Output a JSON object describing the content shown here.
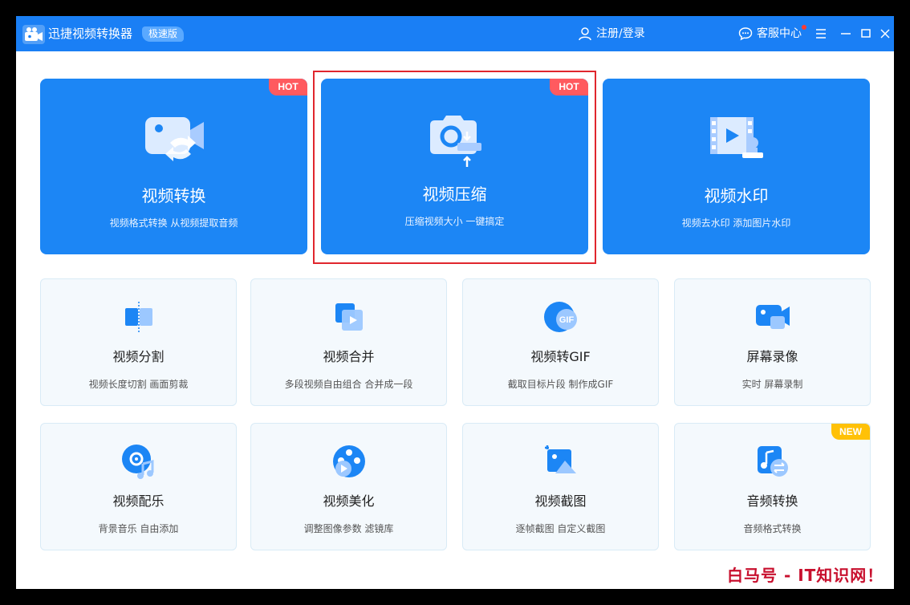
{
  "titlebar": {
    "app_name": "迅捷视频转换器",
    "edition": "极速版",
    "login": "注册/登录",
    "support": "客服中心",
    "icons": [
      "camera-logo-icon",
      "user-icon",
      "chat-icon",
      "menu-icon",
      "minimize-icon",
      "maximize-icon",
      "close-icon"
    ]
  },
  "colors": {
    "primary": "#1a7ff5",
    "card_blue": "#1c86f5",
    "hot": "#ff5a5f",
    "new": "#ffc107",
    "highlight": "#e0262d",
    "watermark": "#c8102e"
  },
  "big_cards": [
    {
      "title": "视频转换",
      "desc": "视频格式转换 从视频提取音频",
      "badge": "HOT",
      "icon": "video-convert-icon"
    },
    {
      "title": "视频压缩",
      "desc": "压缩视频大小 一键搞定",
      "badge": "HOT",
      "icon": "camera-compress-icon"
    },
    {
      "title": "视频水印",
      "desc": "视频去水印 添加图片水印",
      "badge": "",
      "icon": "film-stamp-icon"
    }
  ],
  "small_cards": [
    {
      "title": "视频分割",
      "desc": "视频长度切割 画面剪裁",
      "icon": "split-icon"
    },
    {
      "title": "视频合并",
      "desc": "多段视频自由组合 合并成一段",
      "icon": "merge-icon"
    },
    {
      "title": "视频转GIF",
      "desc": "截取目标片段 制作成GIF",
      "icon": "gif-icon",
      "icon_text": "GIF"
    },
    {
      "title": "屏幕录像",
      "desc": "实时 屏幕录制",
      "icon": "screen-record-icon"
    },
    {
      "title": "视频配乐",
      "desc": "背景音乐 自由添加",
      "icon": "music-disc-icon"
    },
    {
      "title": "视频美化",
      "desc": "调整图像参数 滤镜库",
      "icon": "film-reel-icon"
    },
    {
      "title": "视频截图",
      "desc": "逐帧截图 自定义截图",
      "icon": "crop-image-icon"
    },
    {
      "title": "音频转换",
      "desc": "音频格式转换",
      "icon": "audio-convert-icon",
      "badge": "NEW"
    }
  ],
  "watermark": "白马号 - IT知识网！"
}
